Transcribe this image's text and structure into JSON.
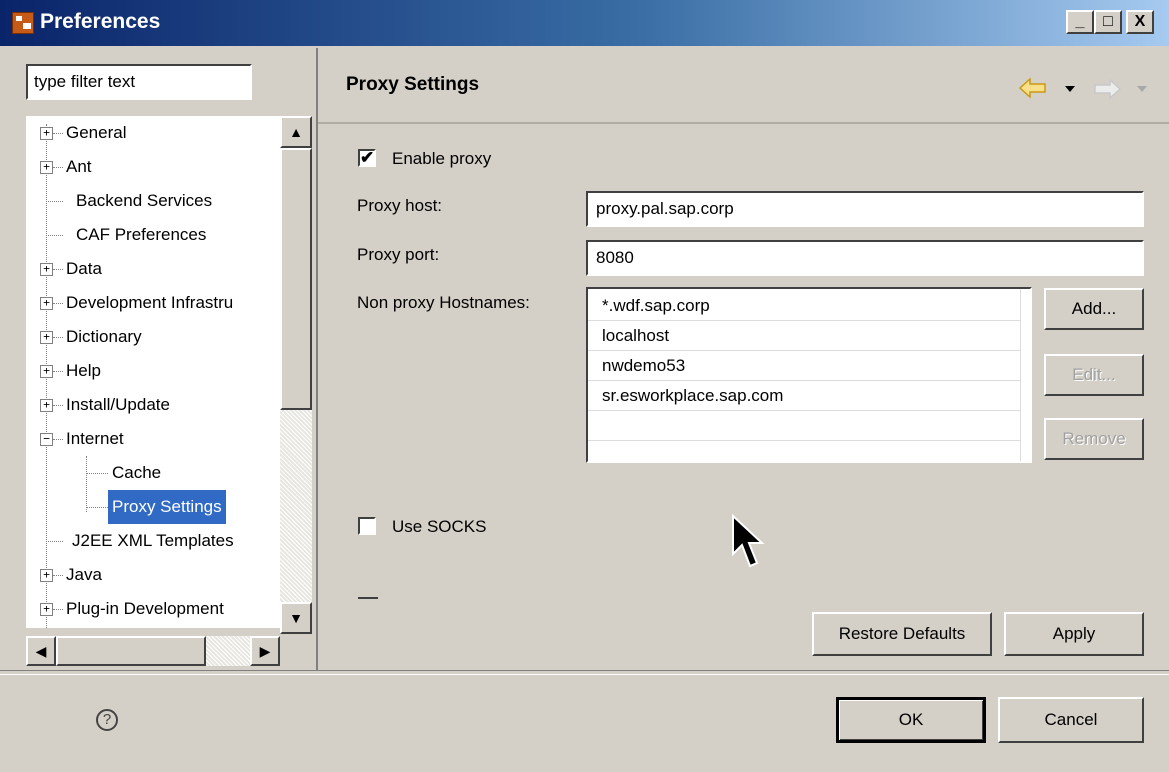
{
  "window": {
    "title": "Preferences",
    "minimize": "_",
    "maximize": "□",
    "close": "X"
  },
  "filter": {
    "value": "type filter text"
  },
  "tree": {
    "items": [
      {
        "label": "General",
        "expander": "+",
        "level": 0
      },
      {
        "label": "Ant",
        "expander": "+",
        "level": 0
      },
      {
        "label": "Backend Services",
        "expander": "",
        "level": 0
      },
      {
        "label": "CAF Preferences",
        "expander": "",
        "level": 0
      },
      {
        "label": "Data",
        "expander": "+",
        "level": 0
      },
      {
        "label": "Development Infrastru",
        "expander": "+",
        "level": 0
      },
      {
        "label": "Dictionary",
        "expander": "+",
        "level": 0
      },
      {
        "label": "Help",
        "expander": "+",
        "level": 0
      },
      {
        "label": "Install/Update",
        "expander": "+",
        "level": 0
      },
      {
        "label": "Internet",
        "expander": "−",
        "level": 0
      },
      {
        "label": "Cache",
        "expander": "",
        "level": 1
      },
      {
        "label": "Proxy Settings",
        "expander": "",
        "level": 1,
        "selected": true
      },
      {
        "label": "J2EE XML Templates",
        "expander": "",
        "level": 0
      },
      {
        "label": "Java",
        "expander": "+",
        "level": 0
      },
      {
        "label": "Plug-in Development",
        "expander": "+",
        "level": 0
      }
    ]
  },
  "page": {
    "title": "Proxy Settings",
    "enable_proxy": {
      "label": "Enable proxy",
      "checked": true,
      "mark": "✔"
    },
    "proxy_host": {
      "label": "Proxy host:",
      "value": "proxy.pal.sap.corp"
    },
    "proxy_port": {
      "label": "Proxy port:",
      "value": "8080"
    },
    "non_proxy": {
      "label": "Non proxy Hostnames:",
      "items": [
        "*.wdf.sap.corp",
        "localhost",
        "nwdemo53",
        "sr.esworkplace.sap.com"
      ],
      "add": "Add...",
      "edit": "Edit...",
      "remove": "Remove"
    },
    "use_socks": {
      "label": "Use SOCKS",
      "checked": false
    },
    "restore_defaults": "Restore Defaults",
    "apply": "Apply"
  },
  "footer": {
    "ok": "OK",
    "cancel": "Cancel",
    "help": "?"
  },
  "colors": {
    "selection": "#316ac5",
    "title_start": "#0a246a",
    "title_end": "#a6caf0"
  }
}
